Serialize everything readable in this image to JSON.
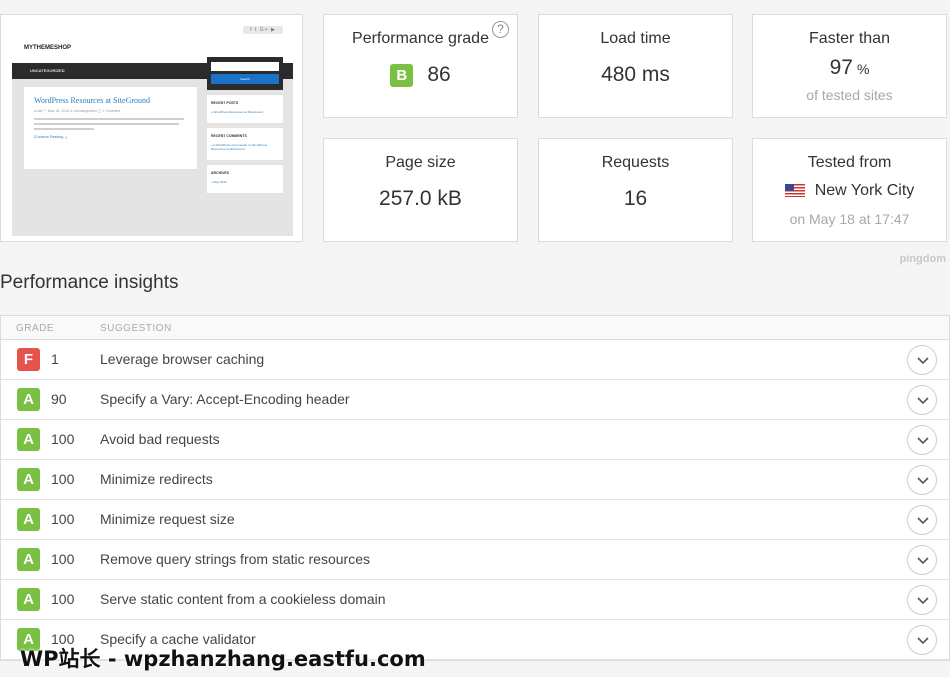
{
  "thumbnail": {
    "brand": "MYTHEMESHOP",
    "nav_item": "UNCATEGORIZED",
    "social": "f t G+ ▶",
    "post_title": "WordPress Resources at SiteGround",
    "post_meta": "● site  ▢ May 18, 2016  ⊘ Uncategorized  ◯ 1 Comment",
    "read_more": "[Continue Reading...]",
    "search_button": "Search",
    "widgets": [
      {
        "heading": "RECENT POSTS",
        "link": "» WordPress Resources at SiteGround"
      },
      {
        "heading": "RECENT COMMENTS",
        "link": "» A WordPress Commenter on WordPress Resources at SiteGround"
      },
      {
        "heading": "ARCHIVES",
        "link": "» May 2016"
      }
    ]
  },
  "stats": {
    "performance_grade": {
      "label": "Performance grade",
      "grade": "B",
      "score": "86",
      "grade_color": "#7ac143"
    },
    "load_time": {
      "label": "Load time",
      "value": "480 ms"
    },
    "faster_than": {
      "label": "Faster than",
      "value": "97",
      "unit": "%",
      "sub": "of tested sites"
    },
    "page_size": {
      "label": "Page size",
      "value": "257.0 kB"
    },
    "requests": {
      "label": "Requests",
      "value": "16"
    },
    "tested_from": {
      "label": "Tested from",
      "city": "New York City",
      "flag": "us-flag-icon",
      "sub": "on May 18 at 17:47"
    }
  },
  "brand_mark": "pingdom",
  "insights": {
    "title": "Performance insights",
    "columns": {
      "grade": "GRADE",
      "suggestion": "SUGGESTION"
    },
    "rows": [
      {
        "grade": "F",
        "score": "1",
        "suggestion": "Leverage browser caching",
        "color": "#e5534b"
      },
      {
        "grade": "A",
        "score": "90",
        "suggestion": "Specify a Vary: Accept-Encoding header",
        "color": "#7ac143"
      },
      {
        "grade": "A",
        "score": "100",
        "suggestion": "Avoid bad requests",
        "color": "#7ac143"
      },
      {
        "grade": "A",
        "score": "100",
        "suggestion": "Minimize redirects",
        "color": "#7ac143"
      },
      {
        "grade": "A",
        "score": "100",
        "suggestion": "Minimize request size",
        "color": "#7ac143"
      },
      {
        "grade": "A",
        "score": "100",
        "suggestion": "Remove query strings from static resources",
        "color": "#7ac143"
      },
      {
        "grade": "A",
        "score": "100",
        "suggestion": "Serve static content from a cookieless domain",
        "color": "#7ac143"
      },
      {
        "grade": "A",
        "score": "100",
        "suggestion": "Specify a cache validator",
        "color": "#7ac143"
      }
    ]
  },
  "watermark": "WP站长 - wpzhanzhang.eastfu.com"
}
